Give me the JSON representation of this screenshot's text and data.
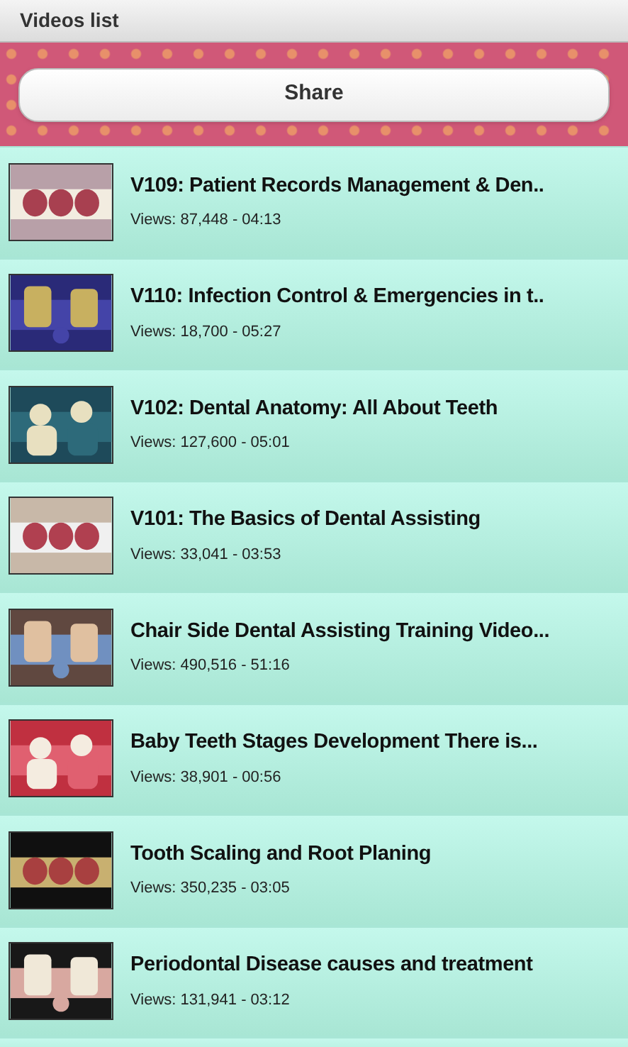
{
  "header": {
    "title": "Videos list"
  },
  "share_button": {
    "label": "Share"
  },
  "videos": [
    {
      "title": "V109: Patient Records Management & Den..",
      "views": "Views: 87,448 - 04:13"
    },
    {
      "title": "V110: Infection Control & Emergencies in t..",
      "views": "Views: 18,700 - 05:27"
    },
    {
      "title": "V102: Dental Anatomy: All About Teeth",
      "views": "Views: 127,600 - 05:01"
    },
    {
      "title": "V101: The Basics of Dental Assisting",
      "views": "Views: 33,041 - 03:53"
    },
    {
      "title": "Chair Side Dental Assisting Training Video...",
      "views": "Views: 490,516 - 51:16"
    },
    {
      "title": "Baby Teeth Stages Development There is...",
      "views": "Views: 38,901 - 00:56"
    },
    {
      "title": "Tooth Scaling and Root Planing",
      "views": "Views: 350,235 - 03:05"
    },
    {
      "title": "Periodontal Disease causes and treatment",
      "views": "Views: 131,941 - 03:12"
    }
  ]
}
